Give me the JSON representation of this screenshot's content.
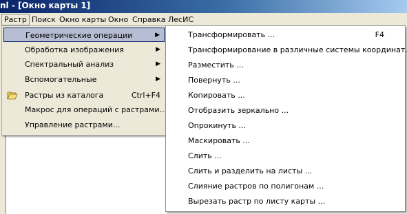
{
  "window": {
    "title_fragment": "nl - [Окно карты 1]"
  },
  "menubar": {
    "items": [
      {
        "label": "Растр",
        "open": true
      },
      {
        "label": "Поиск"
      },
      {
        "label": "Окно карты"
      },
      {
        "label": "Окно"
      },
      {
        "label": "Справка"
      },
      {
        "label": "ЛесИС"
      }
    ]
  },
  "raster_menu": {
    "items": [
      {
        "label": "Геометрические операции",
        "submenu": true,
        "highlighted": true
      },
      {
        "label": "Обработка изображения",
        "submenu": true
      },
      {
        "label": "Спектральный анализ",
        "submenu": true
      },
      {
        "label": "Вспомогательные",
        "submenu": true
      },
      {
        "label": "Растры из каталога",
        "shortcut": "Ctrl+F4",
        "icon": "folder-open-icon"
      },
      {
        "label": "Макрос для операций с растрами..."
      },
      {
        "label": "Управление растрами..."
      }
    ]
  },
  "geometry_submenu": {
    "items": [
      {
        "label": "Трансформировать ...",
        "shortcut": "F4"
      },
      {
        "label": "Трансформирование в различные системы координат..."
      },
      {
        "label": "Разместить ..."
      },
      {
        "label": "Повернуть ..."
      },
      {
        "label": "Копировать ..."
      },
      {
        "label": "Отобразить зеркально ..."
      },
      {
        "label": "Опрокинуть ..."
      },
      {
        "label": "Маскировать ..."
      },
      {
        "label": "Слить ..."
      },
      {
        "label": "Слить и разделить на листы ..."
      },
      {
        "label": "Слияние растров по полигонам ..."
      },
      {
        "label": "Вырезать растр по листу карты ..."
      }
    ]
  },
  "colors": {
    "highlight": "#b6bdd2",
    "highlight_border": "#0a246a",
    "menu_bg": "#ece9d8"
  }
}
